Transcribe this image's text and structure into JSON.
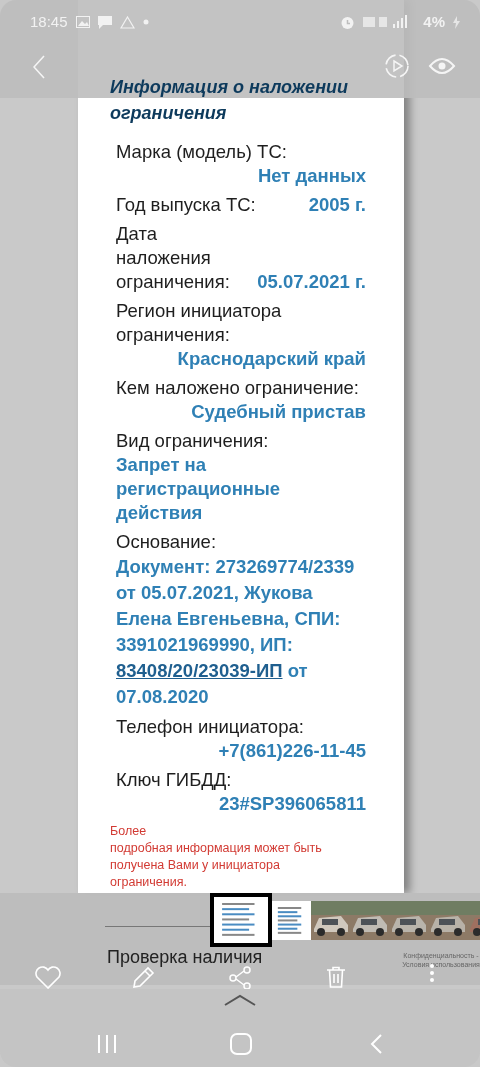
{
  "status_bar": {
    "time": "18:45",
    "battery": "4%"
  },
  "document": {
    "title": "Информация о наложении ограничения",
    "fields": [
      {
        "kind": "below-right",
        "label": "Марка (модель) ТС:",
        "value": "Нет данных"
      },
      {
        "kind": "inline",
        "label": "Год выпуска ТС:",
        "value": "2005 г."
      },
      {
        "kind": "inline",
        "label": "Дата наложения ограничения:",
        "value": "05.07.2021 г."
      },
      {
        "kind": "below-right",
        "label": "Регион инициатора ограничения:",
        "value": "Краснодарский край"
      },
      {
        "kind": "below-right",
        "label": "Кем наложено ограничение:",
        "value": "Судебный пристав"
      },
      {
        "kind": "below-left",
        "label": "Вид ограничения:",
        "value": "Запрет на регистрационные действия"
      },
      {
        "kind": "basis",
        "label": "Основание:",
        "value": "Документ: 273269774/2339 от 05.07.2021, Жукова Елена Евгеньевна, СПИ: 3391021969990, ИП: ",
        "link": "83408/20/23039-ИП",
        "value_after": " от 07.08.2020"
      },
      {
        "kind": "below-right",
        "label": "Телефон инициатора:",
        "value": "+7(861)226-11-45"
      },
      {
        "kind": "below-right",
        "label": "Ключ ГИБДД:",
        "value": "23#SP396065811"
      }
    ],
    "note_lines": [
      "Более",
      "подробная информация может быть",
      "получена Вами у инициатора",
      "ограничения."
    ]
  },
  "filmstrip": [
    {
      "kind": "document",
      "selected": true
    },
    {
      "kind": "document",
      "selected": false
    },
    {
      "kind": "car",
      "selected": false
    },
    {
      "kind": "car",
      "selected": false
    },
    {
      "kind": "car",
      "selected": false
    },
    {
      "kind": "car",
      "selected": false
    },
    {
      "kind": "car",
      "selected": false
    }
  ],
  "privacy_notice": "Конфиденциальность - Условия использования",
  "caption_peek": "Проверка наличия"
}
